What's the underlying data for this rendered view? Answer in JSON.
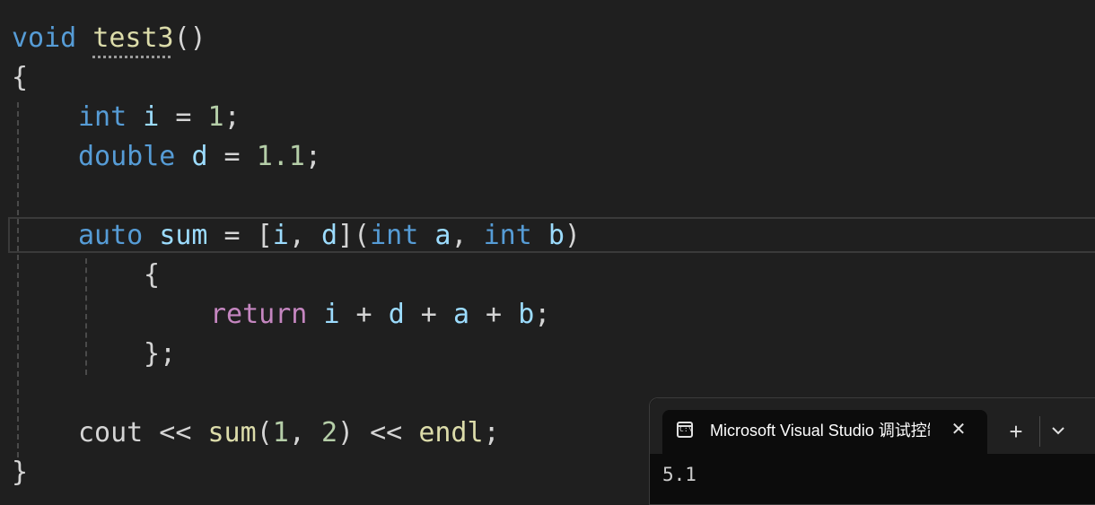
{
  "code": {
    "line1": {
      "kw": "void",
      "fn": "test3",
      "rest": "()"
    },
    "line2": {
      "brace": "{"
    },
    "line3": {
      "kw": "int",
      "var": "i",
      "op": " = ",
      "num": "1",
      "end": ";"
    },
    "line4": {
      "kw": "double",
      "var": "d",
      "op": " = ",
      "num": "1.1",
      "end": ";"
    },
    "line6": {
      "kw": "auto",
      "var": "sum",
      "op": " = ",
      "cap_open": "[",
      "cap_i": "i",
      "cap_sep": ", ",
      "cap_d": "d",
      "cap_close": "](",
      "p1_kw": "int",
      "p1_var": "a",
      "psep": ", ",
      "p2_kw": "int",
      "p2_var": "b",
      "pclose": ")"
    },
    "line7": {
      "brace": "{"
    },
    "line8": {
      "ctl": "return",
      "v1": "i",
      "o1": " + ",
      "v2": "d",
      "o2": " + ",
      "v3": "a",
      "o3": " + ",
      "v4": "b",
      "end": ";"
    },
    "line9": {
      "brace": "};"
    },
    "line11": {
      "fn1": "cout",
      "op1": " << ",
      "fn2": "sum",
      "p_open": "(",
      "n1": "1",
      "sep": ", ",
      "n2": "2",
      "p_close": ")",
      "op2": " << ",
      "fn3": "endl",
      "end": ";"
    },
    "line12": {
      "brace": "}"
    }
  },
  "terminal": {
    "icon_text": "C:\\",
    "tab_title": "Microsoft Visual Studio 调试控制台",
    "close_glyph": "✕",
    "new_tab_glyph": "+",
    "output": "5.1"
  }
}
